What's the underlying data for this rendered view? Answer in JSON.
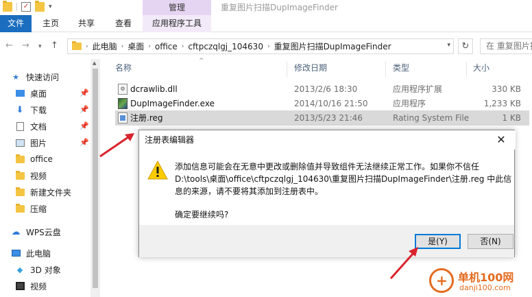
{
  "titlebar": {
    "manage_tab": "管理",
    "window_title": "重复图片扫描DupImageFinder"
  },
  "ribbon": {
    "file": "文件",
    "home": "主页",
    "share": "共享",
    "view": "查看",
    "app_tools": "应用程序工具"
  },
  "address": {
    "crumbs": [
      "此电脑",
      "桌面",
      "office",
      "cftpczqlgj_104630",
      "重复图片扫描DupImageFinder"
    ],
    "search_placeholder": "在 重复图片扫"
  },
  "sidebar": {
    "items": [
      {
        "label": "快速访问",
        "icon": "star-icon",
        "pinned": false
      },
      {
        "label": "桌面",
        "icon": "desktop-icon",
        "pinned": true
      },
      {
        "label": "下载",
        "icon": "download-icon",
        "pinned": true
      },
      {
        "label": "文档",
        "icon": "document-icon",
        "pinned": true
      },
      {
        "label": "图片",
        "icon": "picture-icon",
        "pinned": true
      },
      {
        "label": "office",
        "icon": "folder-icon",
        "pinned": false
      },
      {
        "label": "视频",
        "icon": "folder-icon",
        "pinned": false
      },
      {
        "label": "新建文件夹",
        "icon": "folder-icon",
        "pinned": false
      },
      {
        "label": "压缩",
        "icon": "folder-icon",
        "pinned": false
      },
      {
        "label": "WPS云盘",
        "icon": "cloud-icon",
        "pinned": false
      },
      {
        "label": "此电脑",
        "icon": "computer-icon",
        "pinned": false
      },
      {
        "label": "3D 对象",
        "icon": "cube-icon",
        "pinned": false
      },
      {
        "label": "视频",
        "icon": "video-icon",
        "pinned": false
      }
    ]
  },
  "columns": {
    "name": "名称",
    "date": "修改日期",
    "type": "类型",
    "size": "大小"
  },
  "files": [
    {
      "name": "dcrawlib.dll",
      "date": "2013/2/6 18:30",
      "type": "应用程序扩展",
      "size": "330 KB",
      "icon": "dll-icon"
    },
    {
      "name": "DupImageFinder.exe",
      "date": "2014/10/16 21:50",
      "type": "应用程序",
      "size": "1,233 KB",
      "icon": "exe-icon"
    },
    {
      "name": "注册.reg",
      "date": "2013/5/23 21:46",
      "type": "Rating System File",
      "size": "1 KB",
      "icon": "reg-icon"
    }
  ],
  "dialog": {
    "title": "注册表编辑器",
    "message_lines": [
      "添加信息可能会在无意中更改或删除值并导致组件无法继续正常工作。如果你不信任",
      "D:\\tools\\桌面\\office\\cftpczqlgj_104630\\重复图片扫描DupImageFinder\\注册.reg 中此信",
      "息的来源，请不要将其添加到注册表中。"
    ],
    "confirm": "确定要继续吗?",
    "yes": "是(Y)",
    "no": "否(N)"
  },
  "watermark": {
    "cn": "单机100网",
    "url": "danji100.com"
  },
  "colors": {
    "file_tab": "#1a6dbf",
    "manage_tab": "#e6d5f2",
    "accent_arrow": "#d9232d",
    "watermark": "#e46b1f"
  }
}
